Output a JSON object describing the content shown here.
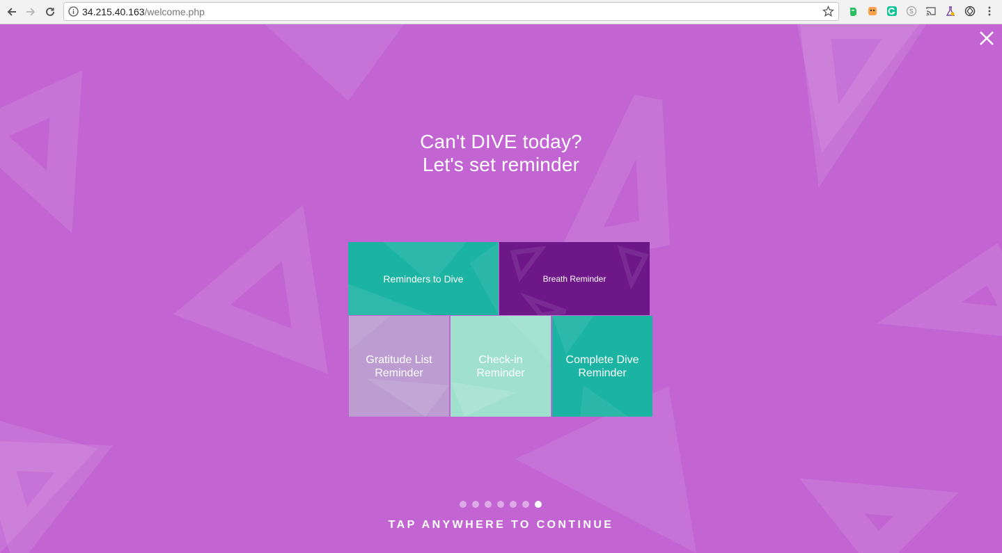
{
  "browser": {
    "url_host": "34.215.40.163",
    "url_path": "/welcome.php",
    "extensions": [
      "evernote-icon",
      "honey-icon",
      "grammarly-icon",
      "skype-icon",
      "cast-icon",
      "lab-icon",
      "vpn-icon"
    ]
  },
  "page": {
    "headline_line1": "Can't DIVE today?",
    "headline_line2": "Let's set reminder",
    "tiles": {
      "reminders_to_dive": "Reminders to Dive",
      "breath_reminder": "Breath Reminder",
      "gratitude_list_line1": "Gratitude List",
      "gratitude_list_line2": "Reminder",
      "check_in_line1": "Check-in",
      "check_in_line2": "Reminder",
      "complete_dive_line1": "Complete Dive",
      "complete_dive_line2": "Reminder"
    },
    "pagination": {
      "total": 7,
      "active_index": 7
    },
    "cta": "TAP ANYWHERE TO CONTINUE"
  },
  "colors": {
    "background": "#c265d3",
    "teal": "#1bb3a2",
    "purple": "#6d1789",
    "lilac": "#bc9cd1",
    "mint": "#9fe0ce"
  }
}
